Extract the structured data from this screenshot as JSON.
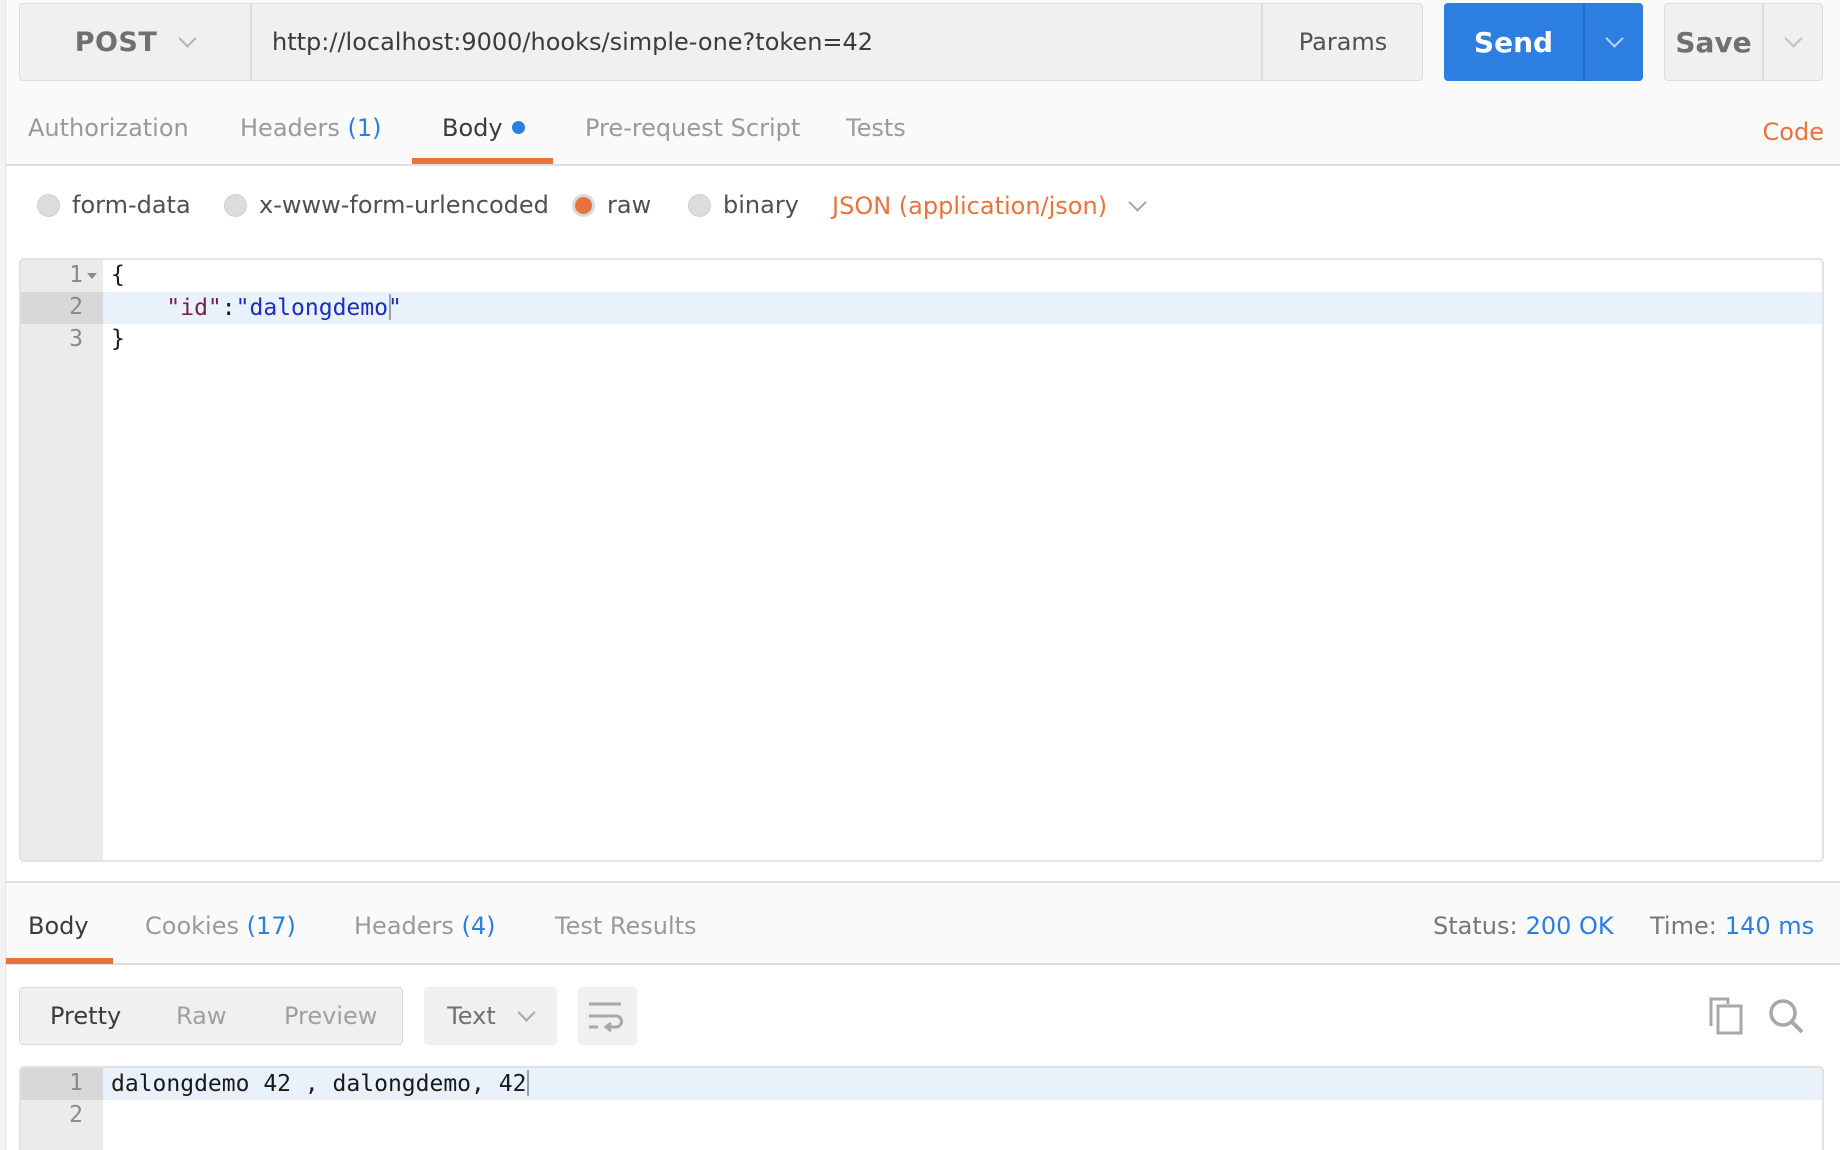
{
  "request": {
    "method": "POST",
    "url": "http://localhost:9000/hooks/simple-one?token=42",
    "params_label": "Params",
    "send_label": "Send",
    "save_label": "Save"
  },
  "request_tabs": {
    "items": [
      {
        "label": "Authorization",
        "count": ""
      },
      {
        "label": "Headers",
        "count": "(1)"
      },
      {
        "label": "Body",
        "count": ""
      },
      {
        "label": "Pre-request Script",
        "count": ""
      },
      {
        "label": "Tests",
        "count": ""
      }
    ],
    "active": "Body",
    "code_link": "Code"
  },
  "body_types": {
    "options": [
      "form-data",
      "x-www-form-urlencoded",
      "raw",
      "binary"
    ],
    "selected": "raw",
    "content_type": "JSON (application/json)"
  },
  "request_body": {
    "lines": [
      {
        "number": "1",
        "text": "{"
      },
      {
        "number": "2",
        "key": "\"id\"",
        "sep": ":",
        "value": "\"dalongdemo\""
      },
      {
        "number": "3",
        "text": "}"
      }
    ]
  },
  "response_tabs": {
    "items": [
      {
        "label": "Body",
        "count": ""
      },
      {
        "label": "Cookies",
        "count": "(17)"
      },
      {
        "label": "Headers",
        "count": "(4)"
      },
      {
        "label": "Test Results",
        "count": ""
      }
    ],
    "active": "Body",
    "status_label": "Status:",
    "status_value": "200 OK",
    "time_label": "Time:",
    "time_value": "140 ms"
  },
  "response_toolbar": {
    "view_modes": [
      "Pretty",
      "Raw",
      "Preview"
    ],
    "active_view": "Pretty",
    "format": "Text"
  },
  "response_body": {
    "lines": [
      {
        "number": "1",
        "text": "dalongdemo 42 , dalongdemo, 42"
      },
      {
        "number": "2",
        "text": ""
      }
    ]
  },
  "colors": {
    "accent_orange": "#e8743b",
    "accent_blue": "#2c7ee0"
  }
}
